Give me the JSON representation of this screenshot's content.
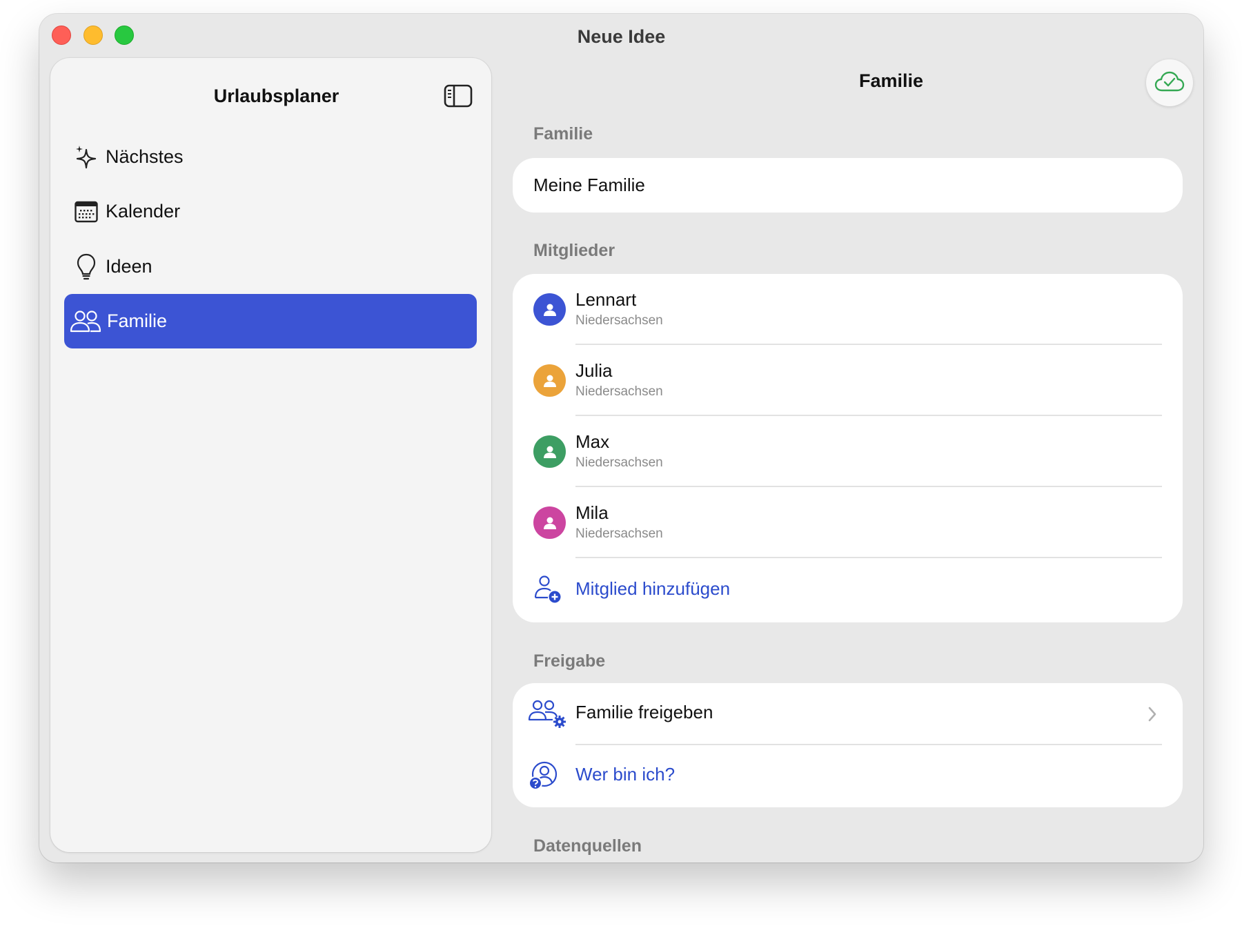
{
  "window": {
    "title": "Neue Idee"
  },
  "sidebar": {
    "title": "Urlaubsplaner",
    "toggle_icon": "sidebar-toggle-icon",
    "items": [
      {
        "label": "Nächstes",
        "icon": "sparkles-icon",
        "active": false
      },
      {
        "label": "Kalender",
        "icon": "calendar-icon",
        "active": false
      },
      {
        "label": "Ideen",
        "icon": "lightbulb-icon",
        "active": false
      },
      {
        "label": "Familie",
        "icon": "people-icon",
        "active": true
      }
    ]
  },
  "main": {
    "title": "Familie",
    "sync_icon": "cloud-check-icon",
    "sections": {
      "family": {
        "header": "Familie",
        "value": "Meine Familie"
      },
      "members": {
        "header": "Mitglieder",
        "list": [
          {
            "name": "Lennart",
            "region": "Niedersachsen",
            "color": "#3c54d4"
          },
          {
            "name": "Julia",
            "region": "Niedersachsen",
            "color": "#eba33a"
          },
          {
            "name": "Max",
            "region": "Niedersachsen",
            "color": "#3d9e63"
          },
          {
            "name": "Mila",
            "region": "Niedersachsen",
            "color": "#cc45a0"
          }
        ],
        "add_label": "Mitglied hinzufügen"
      },
      "sharing": {
        "header": "Freigabe",
        "share_label": "Familie freigeben",
        "whoami_label": "Wer bin ich?"
      },
      "sources": {
        "header": "Datenquellen"
      }
    }
  },
  "colors": {
    "accent": "#3c54d4",
    "link": "#2b4bcc",
    "cloud": "#34a853"
  }
}
